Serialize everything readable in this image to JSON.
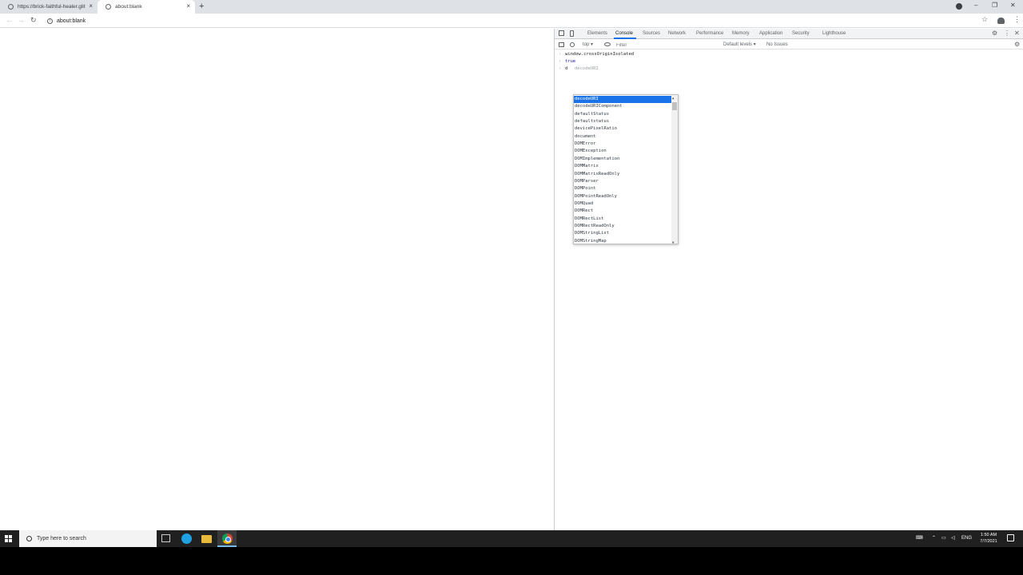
{
  "browser": {
    "tabs": [
      {
        "title": "https://brick-faithful-healer.glit"
      },
      {
        "title": "about:blank"
      }
    ],
    "new_tab_symbol": "+",
    "tab_close_symbol": "×",
    "address": "about:blank",
    "window_controls": {
      "minimize": "–",
      "maximize": "❐",
      "close": "✕"
    }
  },
  "devtools": {
    "tabs": [
      "Elements",
      "Console",
      "Sources",
      "Network",
      "Performance",
      "Memory",
      "Application",
      "Security",
      "Lighthouse"
    ],
    "active_tab": "Console",
    "context": "top ▾",
    "filter_placeholder": "Filter",
    "levels": "Default levels ▾",
    "issues": "No Issues",
    "console_lines": [
      {
        "prompt": "›",
        "text": "window.crossOriginIsolated"
      },
      {
        "prompt": "‹",
        "text": "true"
      },
      {
        "prompt": "›",
        "text": "d",
        "hint": "decodeURI"
      }
    ],
    "autocomplete": {
      "selected_index": 0,
      "items": [
        "decodeURI",
        "decodeURIComponent",
        "defaultStatus",
        "defaultstatus",
        "devicePixelRatio",
        "document",
        "DOMError",
        "DOMException",
        "DOMImplementation",
        "DOMMatrix",
        "DOMMatrixReadOnly",
        "DOMParser",
        "DOMPoint",
        "DOMPointReadOnly",
        "DOMQuad",
        "DOMRect",
        "DOMRectList",
        "DOMRectReadOnly",
        "DOMStringList",
        "DOMStringMap"
      ]
    }
  },
  "taskbar": {
    "search_placeholder": "Type here to search",
    "language": "ENG",
    "time": "1:50 AM",
    "date": "7/7/2021"
  }
}
